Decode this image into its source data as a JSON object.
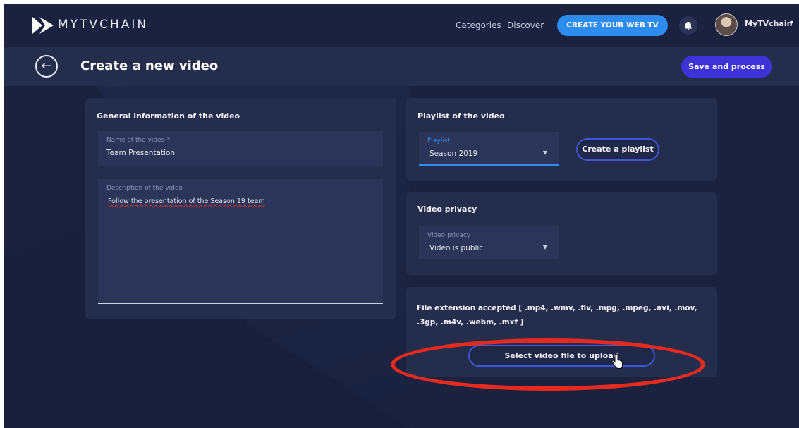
{
  "brand": {
    "name": "MYTVCHAIN"
  },
  "nav": {
    "categories": "Categories",
    "discover": "Discover",
    "cta": "CREATE YOUR WEB TV",
    "user_name": "MyTVchain"
  },
  "header": {
    "title": "Create a new video",
    "save_label": "Save and process"
  },
  "general": {
    "title": "General information of the video",
    "name_label": "Name of the video *",
    "name_value": "Team Presentation",
    "desc_label": "Description of the video",
    "desc_value": "Follow the presentation of the Season 19 team"
  },
  "playlist": {
    "title": "Playlist of the video",
    "field_label": "Playlist",
    "field_value": "Season 2019",
    "create_label": "Create a playlist"
  },
  "privacy": {
    "title": "Video privacy",
    "field_label": "Video privacy",
    "field_value": "Video is public"
  },
  "upload": {
    "extensions": "File extension accepted [ .mp4, .wmv, .flv, .mpg, .mpeg, .avi, .mov, .3gp, .m4v, .webm, .mxf ]",
    "button_label": "Select video file to upload"
  },
  "colors": {
    "background": "#1a2240",
    "panel": "#252d4d",
    "accent_blue": "#2d8cf0",
    "save_button": "#3d33d8",
    "annotation_red": "#e62b1e"
  },
  "icons": {
    "logo": "mytvchain-logo-icon",
    "bell": "bell-icon",
    "back": "arrow-left-icon",
    "caret": "chevron-down-icon",
    "cursor": "hand-pointer-icon"
  }
}
